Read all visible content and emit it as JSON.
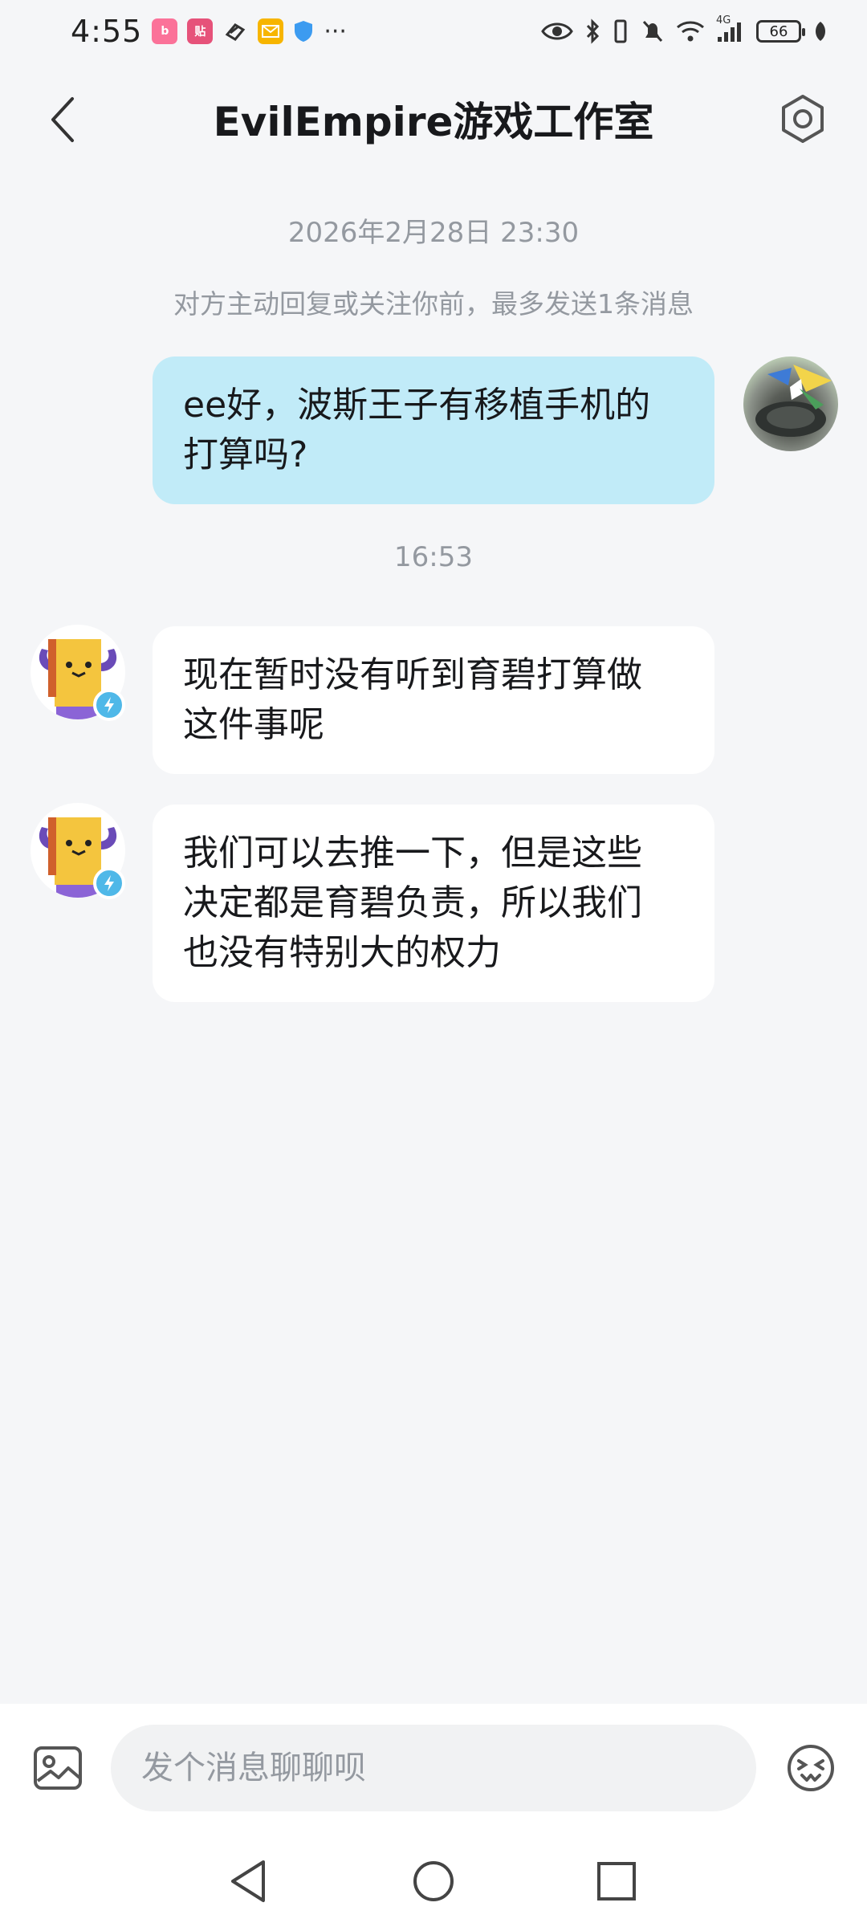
{
  "status_bar": {
    "time": "4:55",
    "network": "4G",
    "battery": "66",
    "app_badges": [
      {
        "icon": "bilibili-badge-icon",
        "color": "#fb7299"
      },
      {
        "icon": "tieba-badge-icon",
        "color": "#e6527a"
      },
      {
        "icon": "phone-link-icon",
        "color": "#333333"
      },
      {
        "icon": "mail-icon",
        "color": "#f7b500"
      },
      {
        "icon": "shield-icon",
        "color": "#3c9bf0"
      }
    ],
    "more_indicator": "···"
  },
  "header": {
    "title": "EvilEmpire游戏工作室"
  },
  "chat": {
    "messages_block1": {
      "timestamp": "2026年2月28日 23:30",
      "notice": "对方主动回复或关注你前，最多发送1条消息",
      "outgoing": {
        "line1": "ee好，波斯王子有移植手机的",
        "line2": "打算吗?"
      }
    },
    "messages_block2": {
      "timestamp": "16:53",
      "incoming1": {
        "line1": "现在暂时没有听到育碧打算做",
        "line2": "这件事呢"
      },
      "incoming2": {
        "line1": "我们可以去推一下，但是这些",
        "line2": "决定都是育碧负责，所以我们",
        "line3": "也没有特别大的权力"
      }
    }
  },
  "input": {
    "placeholder": "发个消息聊聊呗"
  },
  "colors": {
    "outgoing_bubble": "#c1ebf8",
    "incoming_bubble": "#ffffff",
    "background": "#f5f6f8",
    "muted_text": "#9499a0",
    "verified_badge": "#4fb8e8"
  }
}
